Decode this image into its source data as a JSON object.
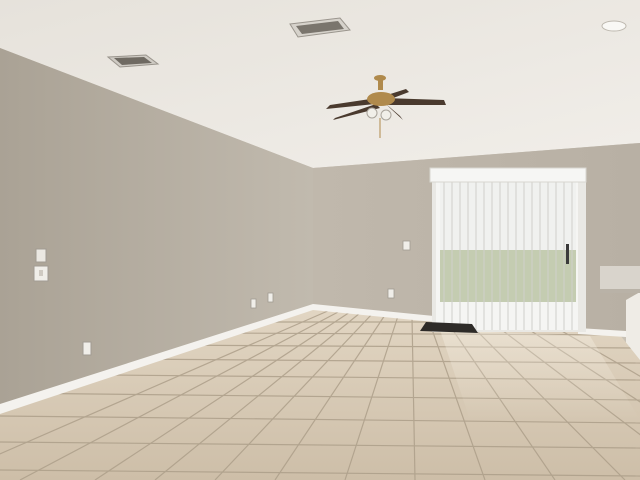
{
  "scene": {
    "colors": {
      "ceiling": "#ece9e3",
      "left_wall": "#b7afa3",
      "back_wall": "#bdb5a9",
      "right_wall": "#c6bfb3",
      "floor_tile": "#d3c5b0",
      "grout": "#a99a85",
      "baseboard": "#f4f2ee",
      "blind": "#f3f3f1",
      "lawn": "#8fa06f",
      "fan_brass": "#b08a4c",
      "fan_blade": "#4a3a2e",
      "mat": "#2e2b28"
    },
    "objects": [
      "ceiling-fan",
      "ceiling-vent",
      "vertical-blinds",
      "sliding-glass-door",
      "door-mat",
      "light-switch",
      "outlet",
      "thermostat",
      "baseboard",
      "tile-floor",
      "recessed-light"
    ]
  }
}
